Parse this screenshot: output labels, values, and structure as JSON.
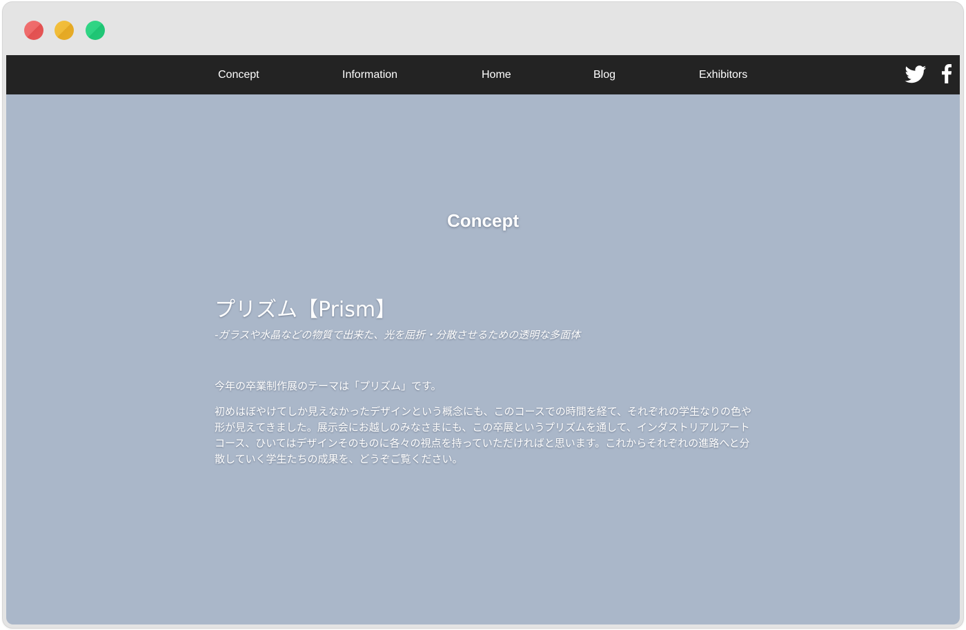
{
  "nav": {
    "links": [
      "Concept",
      "Information",
      "Home",
      "Blog",
      "Exhibitors"
    ],
    "social": [
      "twitter-icon",
      "facebook-icon"
    ]
  },
  "colors": {
    "navbar_bg": "#232323",
    "page_bg": "#aab7c9",
    "text": "#ffffff"
  },
  "section": {
    "title": "Concept"
  },
  "concept": {
    "heading": "プリズム【Prism】",
    "subheading": "-ガラスや水晶などの物質で出来た、光を屈折・分散させるための透明な多面体",
    "paragraph1": "今年の卒業制作展のテーマは「プリズム」です。",
    "paragraph2": "初めはぼやけてしか見えなかったデザインという概念にも、このコースでの時間を経て、それぞれの学生なりの色や形が見えてきました。展示会にお越しのみなさまにも、この卒展というプリズムを通して、インダストリアルアートコース、ひいてはデザインそのものに各々の視点を持っていただければと思います。これからそれぞれの進路へと分散していく学生たちの成果を、どうぞご覧ください。"
  }
}
